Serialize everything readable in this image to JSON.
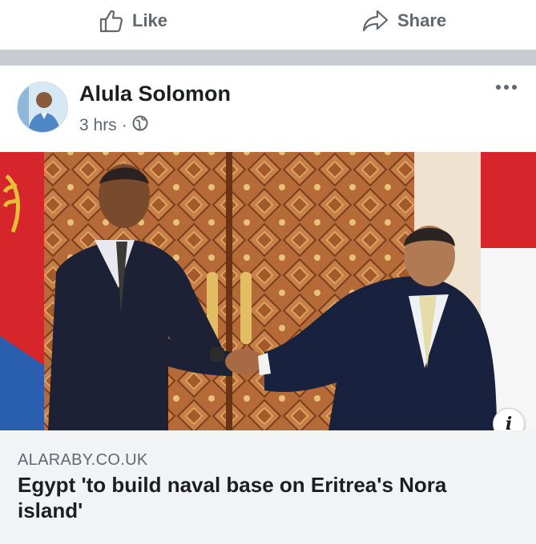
{
  "actions": {
    "like_label": "Like",
    "share_label": "Share"
  },
  "post": {
    "author": "Alula Solomon",
    "time": "3 hrs",
    "separator": "·",
    "privacy_icon": "globe-icon",
    "more_icon": "more-options-icon"
  },
  "link": {
    "domain": "ALARABY.CO.UK",
    "headline": "Egypt 'to build naval base on Eritrea's Nora island'",
    "info_icon": "info-icon",
    "info_glyph": "i"
  },
  "colors": {
    "text_primary": "#1c1e21",
    "text_secondary": "#606770",
    "divider": "#c9ccd1",
    "link_card_bg": "#f2f3f5"
  }
}
